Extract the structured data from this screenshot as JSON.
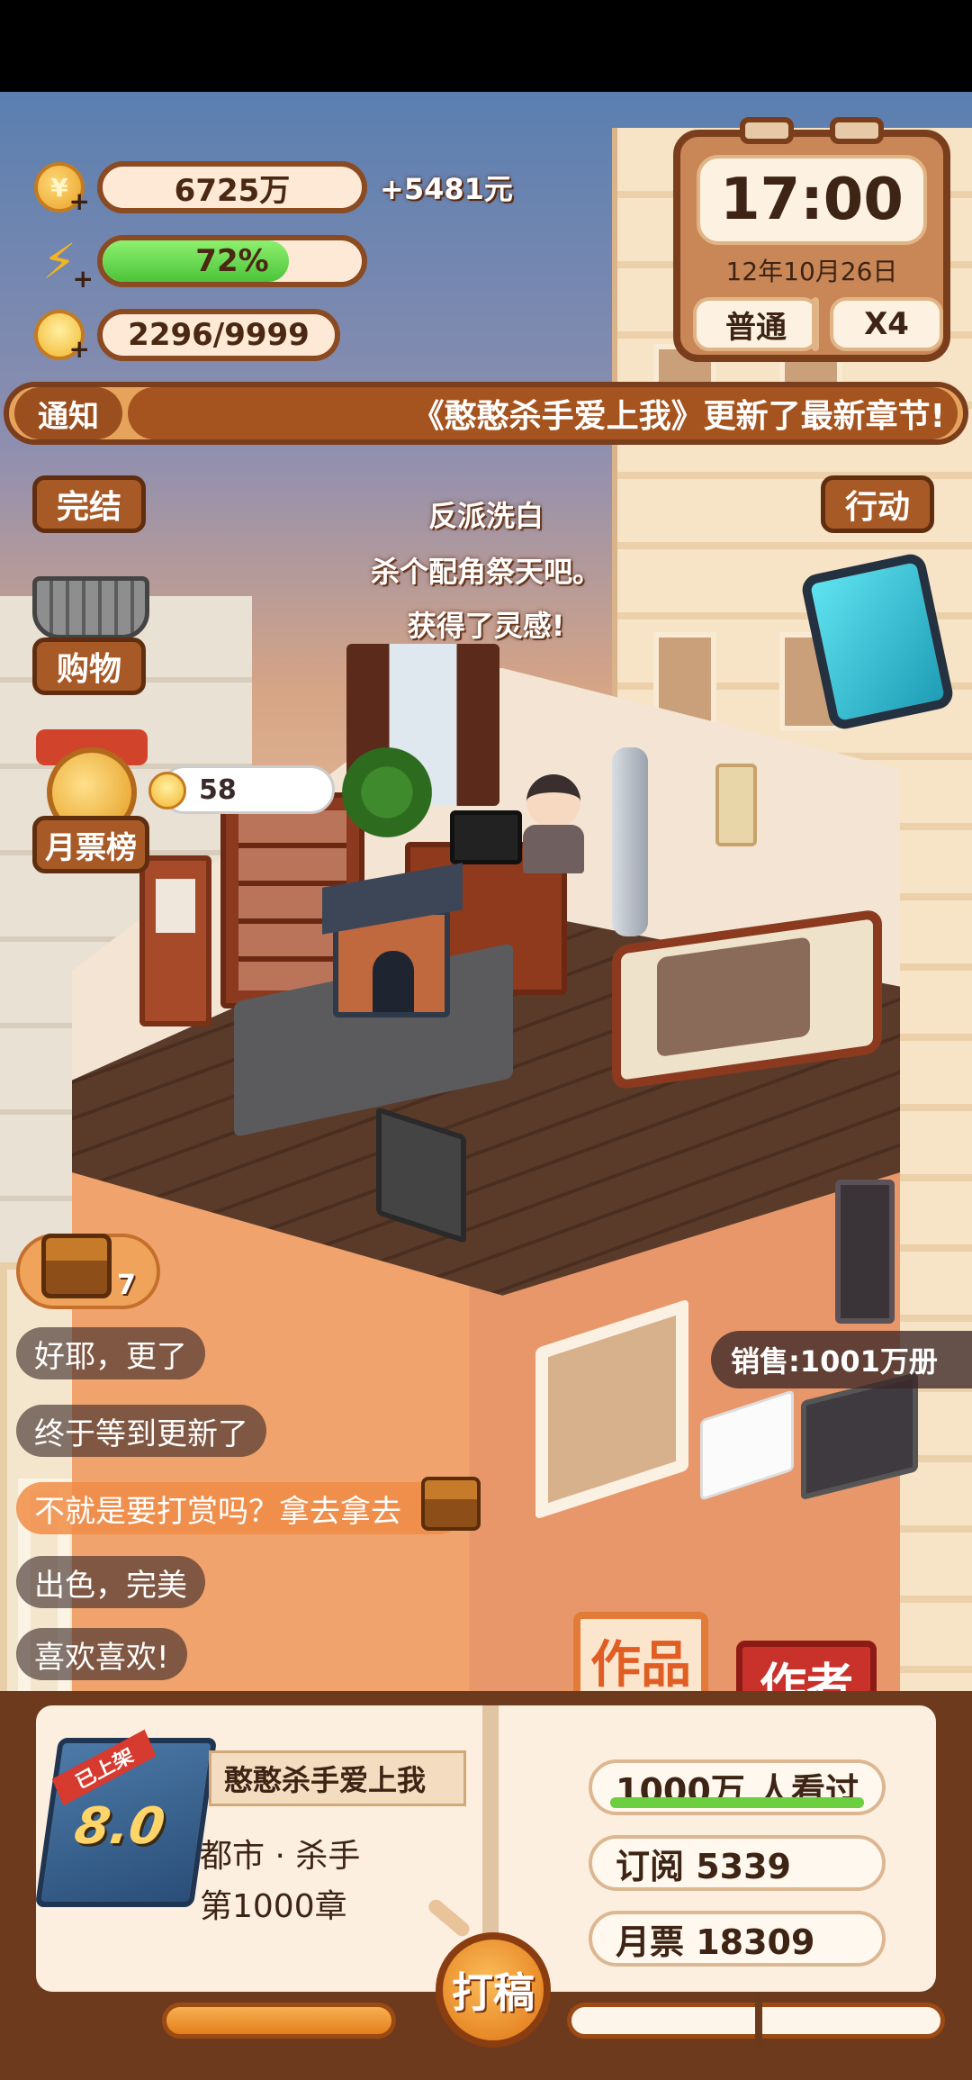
{
  "hud": {
    "money": "6725万",
    "money_delta": "+5481元",
    "energy": "72%",
    "energy_fraction": 0.72,
    "inspiration": "2296/9999"
  },
  "clock": {
    "time": "17:00",
    "date": "12年10月26日",
    "mode_label": "普通",
    "speed_label": "X4"
  },
  "notice": {
    "tag": "通知",
    "message": "《憨憨杀手爱上我》更新了最新章节!"
  },
  "side_menu": {
    "finish_label": "完结",
    "shop_label": "购物",
    "ranking_label": "月票榜",
    "action_label": "行动",
    "vote_count": "58"
  },
  "float_text": [
    "反派洗白",
    "杀个配角祭天吧。",
    "获得了灵感!"
  ],
  "chest": {
    "count": "7"
  },
  "comments": [
    {
      "text": "好耶，更了",
      "gift": false
    },
    {
      "text": "终于等到更新了",
      "gift": false
    },
    {
      "text": "不就是要打赏吗？拿去拿去",
      "gift": true
    },
    {
      "text": "出色，完美",
      "gift": false
    },
    {
      "text": "喜欢喜欢!",
      "gift": false
    }
  ],
  "sales": "销售:1001万册",
  "tabs": {
    "works": "作品",
    "author": "作者"
  },
  "book": {
    "status_ribbon": "已上架",
    "score": "8.0",
    "title": "憨憨杀手爱上我",
    "genre": "都市 · 杀手",
    "chapter": "第1000章",
    "readers": "1000万  人看过",
    "readers_fraction": 1.0,
    "subscriptions": "订阅  5339",
    "monthly_votes": "月票  18309"
  },
  "write_button": "打稿",
  "progress": {
    "left_fraction": 1.0
  }
}
